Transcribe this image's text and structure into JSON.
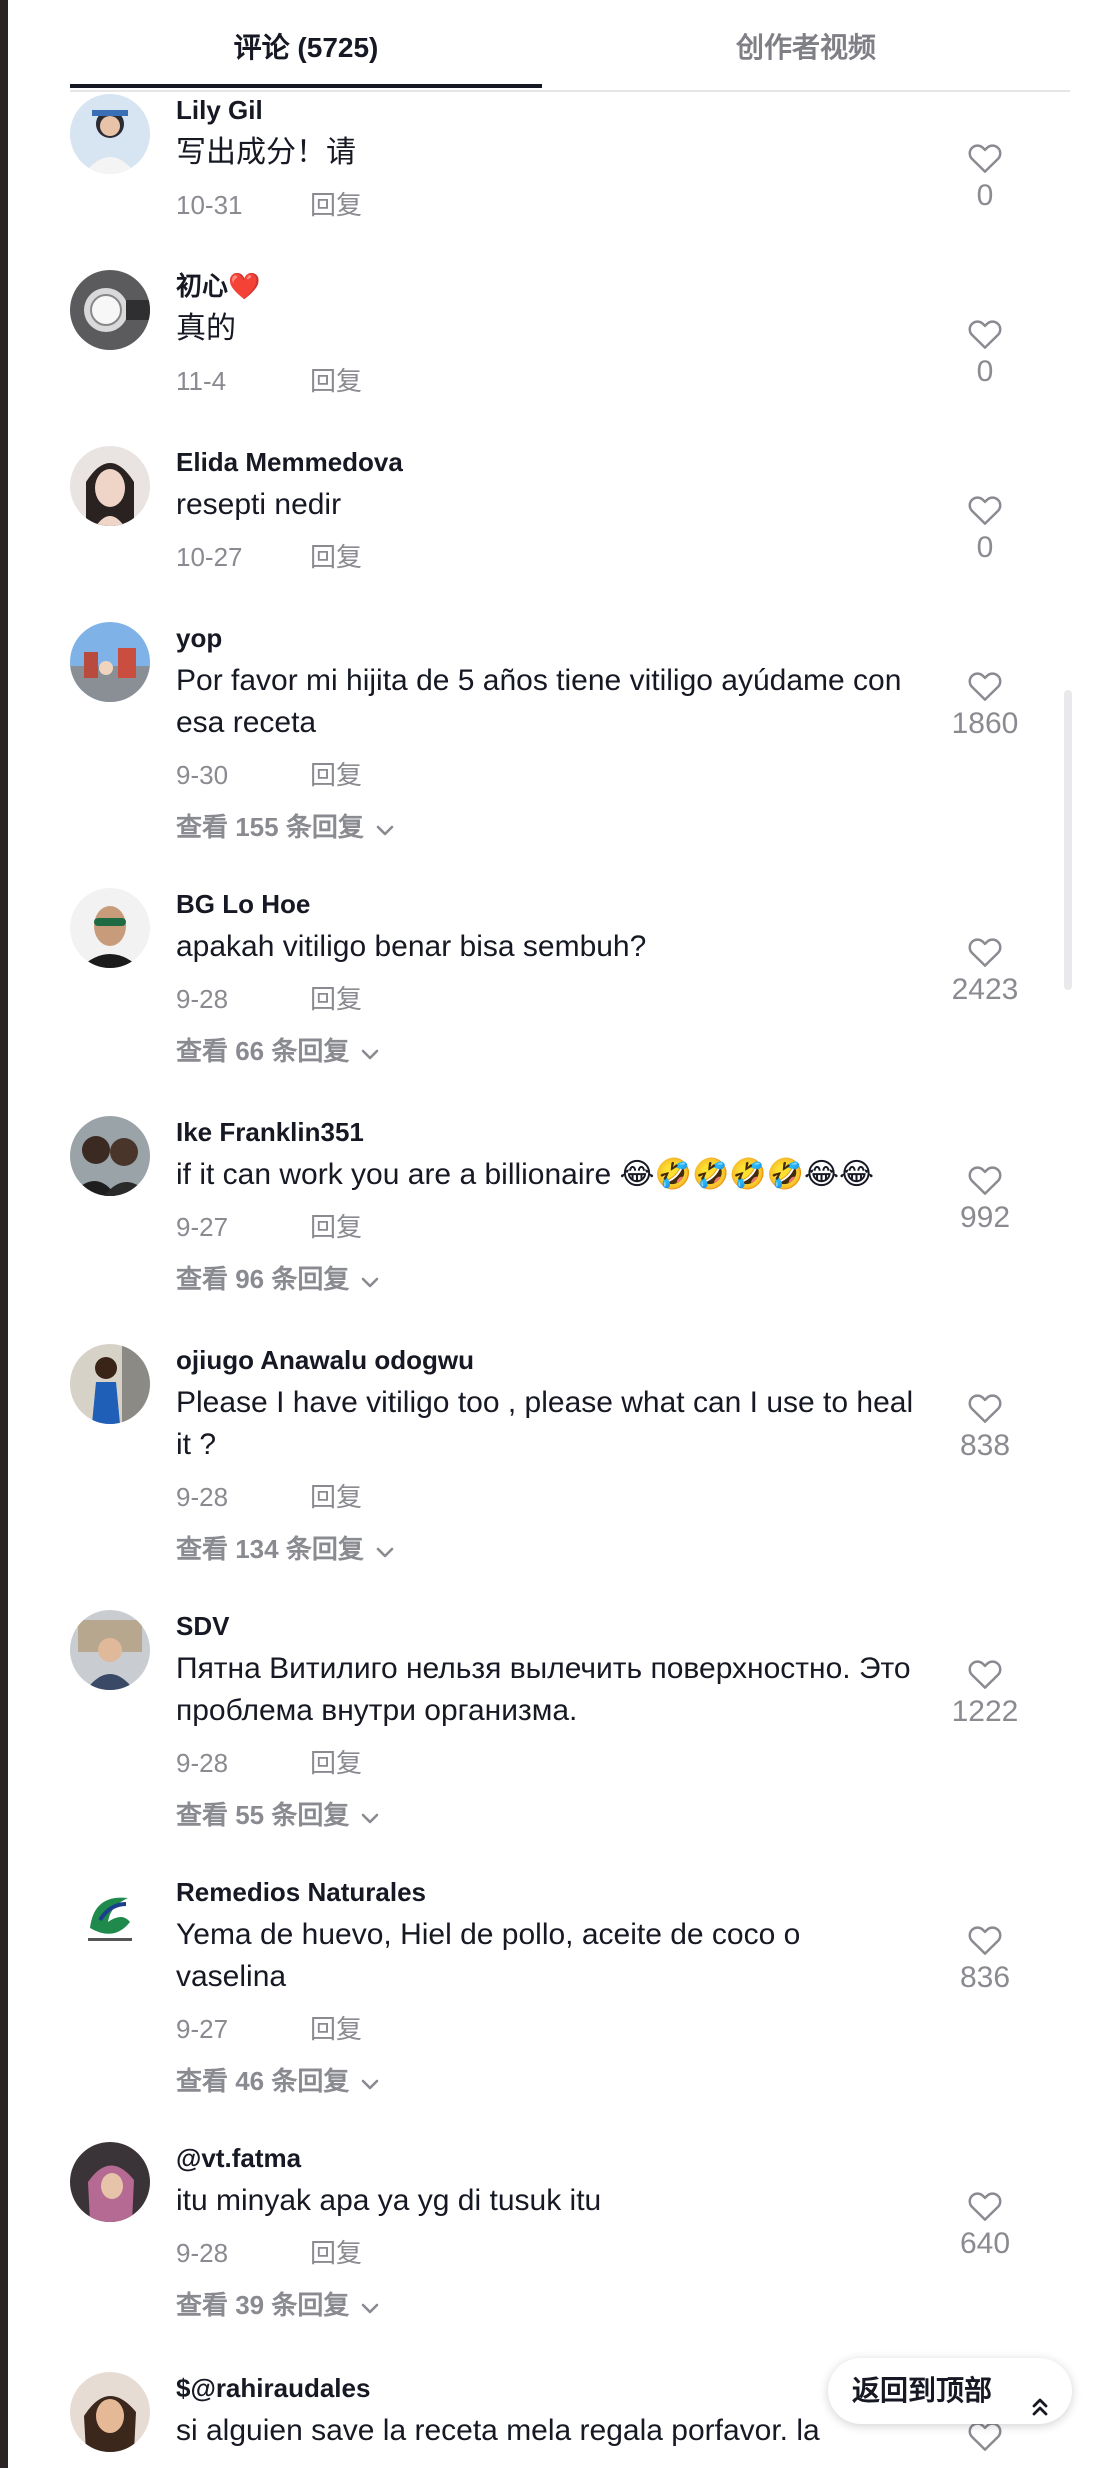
{
  "tabs": {
    "comments": "评论 (5725)",
    "creator_videos": "创作者视频"
  },
  "comments": [
    {
      "user": "Lily Gil",
      "text": "写出成分！请",
      "date": "10-31",
      "reply": "回复",
      "likes": "0",
      "view_replies": ""
    },
    {
      "user": "初心❤️",
      "text": "真的",
      "date": "11-4",
      "reply": "回复",
      "likes": "0",
      "view_replies": ""
    },
    {
      "user": "Elida Memmedova",
      "text": "resepti nedir",
      "date": "10-27",
      "reply": "回复",
      "likes": "0",
      "view_replies": ""
    },
    {
      "user": "yop",
      "text": "Por favor mi hijita de 5 años tiene vitiligo ayúdame con esa receta",
      "date": "9-30",
      "reply": "回复",
      "likes": "1860",
      "view_replies": "查看 155 条回复"
    },
    {
      "user": "BG Lo Hoe",
      "text": "apakah vitiligo benar bisa sembuh?",
      "date": "9-28",
      "reply": "回复",
      "likes": "2423",
      "view_replies": "查看 66 条回复"
    },
    {
      "user": "Ike Franklin351",
      "text": "if it can work you are a billionaire 😂🤣🤣🤣🤣😂😂",
      "date": "9-27",
      "reply": "回复",
      "likes": "992",
      "view_replies": "查看 96 条回复"
    },
    {
      "user": "ojiugo Anawalu odogwu",
      "text": "Please I have vitiligo too , please what can I use to heal it ?",
      "date": "9-28",
      "reply": "回复",
      "likes": "838",
      "view_replies": "查看 134 条回复"
    },
    {
      "user": "SDV",
      "text": "Пятна Витилиго нельзя вылечить поверхностно. Это проблема внутри организма.",
      "date": "9-28",
      "reply": "回复",
      "likes": "1222",
      "view_replies": "查看 55 条回复"
    },
    {
      "user": "Remedios Naturales",
      "text": "Yema de huevo, Hiel de pollo, aceite de coco o vaselina",
      "date": "9-27",
      "reply": "回复",
      "likes": "836",
      "view_replies": "查看 46 条回复"
    },
    {
      "user": "@vt.fatma",
      "text": "itu minyak apa ya yg di tusuk itu",
      "date": "9-28",
      "reply": "回复",
      "likes": "640",
      "view_replies": "查看 39 条回复"
    },
    {
      "user": "$@rahiraudales",
      "text": "si alguien save la receta mela regala porfavor. la",
      "date": "",
      "reply": "",
      "likes": "",
      "view_replies": ""
    }
  ],
  "back_to_top": "返回到顶部"
}
